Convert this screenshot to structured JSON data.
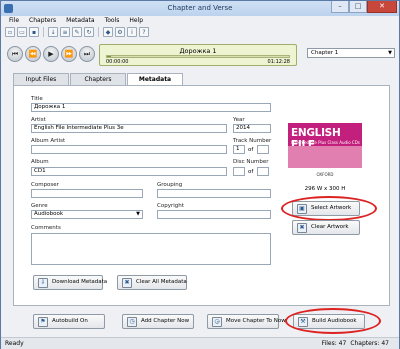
{
  "window": {
    "title": "Chapter and Verse",
    "controls": {
      "minimize": "–",
      "maximize": "□",
      "close": "✕"
    }
  },
  "menu": [
    "File",
    "Chapters",
    "Metadata",
    "Tools",
    "Help"
  ],
  "toolbar_icons": [
    "new-file-icon",
    "open-folder-icon",
    "save-icon",
    "import-icon",
    "split-icon",
    "chapter-edit-icon",
    "refresh-icon",
    "tag-icon",
    "settings-icon",
    "info-icon",
    "help-icon"
  ],
  "player": {
    "track_title": "Дорожка 1",
    "start_time": "00:00:00",
    "end_time": "01:12:28",
    "progress": 0.02,
    "chapter_selected": "Chapter 1"
  },
  "tabs": [
    "Input Files",
    "Chapters",
    "Metadata"
  ],
  "active_tab": "Metadata",
  "metadata": {
    "title_label": "Title",
    "title_value": "Дорожка 1",
    "artist_label": "Artist",
    "artist_value": "English File Intermediate Plus 3e",
    "year_label": "Year",
    "year_value": "2014",
    "album_artist_label": "Album Artist",
    "album_artist_value": "",
    "track_number_label": "Track Number",
    "track_number_value": "1",
    "track_total_value": "",
    "album_label": "Album",
    "album_value": "CD1",
    "disc_number_label": "Disc Number",
    "disc_number_value": "",
    "disc_total_value": "",
    "of_label": "of",
    "composer_label": "Composer",
    "composer_value": "",
    "grouping_label": "Grouping",
    "grouping_value": "",
    "genre_label": "Genre",
    "genre_value": "Audiobook",
    "copyright_label": "Copyright",
    "copyright_value": "",
    "comments_label": "Comments",
    "comments_value": ""
  },
  "buttons": {
    "download_metadata": "Download Metadata",
    "clear_all_metadata": "Clear All Metadata",
    "select_artwork": "Select Artwork",
    "clear_artwork": "Clear Artwork",
    "autobuild": "Autobuild On",
    "add_chapter_now": "Add Chapter Now",
    "move_chapter_to_now": "Move Chapter To Now",
    "build_audiobook": "Build Audiobook"
  },
  "artwork": {
    "cover_title": "ENGLISH FILE",
    "cover_subtitle": "Intermediate Plus  Class Audio CDs",
    "cover_brand": "OXFORD",
    "dimensions": "296 W x 300 H"
  },
  "status": {
    "left": "Ready",
    "files": "Files: 47",
    "chapters": "Chapters: 47"
  },
  "colors": {
    "highlight_ellipse": "#dd2222",
    "cover": "#c3207d"
  }
}
